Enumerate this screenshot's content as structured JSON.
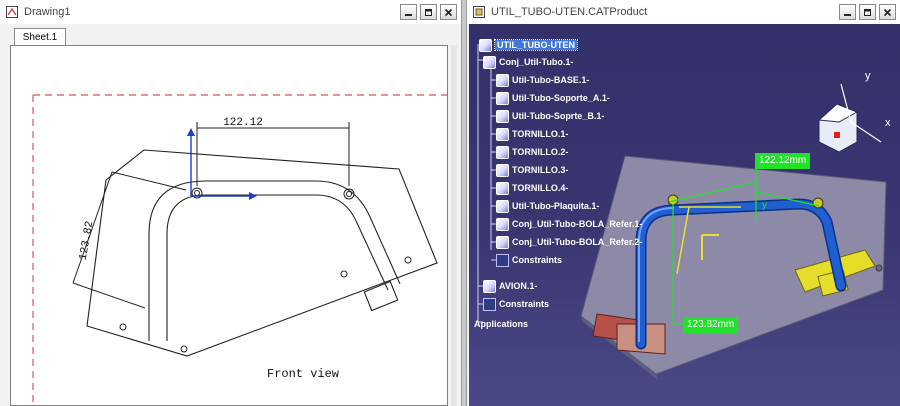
{
  "drawing_window": {
    "title": "Drawing1",
    "tab": "Sheet.1",
    "dim_horizontal": "122.12",
    "dim_vertical": "123.82",
    "view_label": "Front view"
  },
  "product_window": {
    "title": "UTIL_TUBO-UTEN.CATProduct",
    "tree": [
      {
        "label": "UTIL_TUBO-UTEN",
        "icon": "product-icon",
        "selected": true
      },
      {
        "label": "Conj_Util-Tubo.1-",
        "icon": "product-icon"
      },
      {
        "label": "Util-Tubo-BASE.1-",
        "icon": "part-icon"
      },
      {
        "label": "Util-Tubo-Soporte_A.1-",
        "icon": "part-icon"
      },
      {
        "label": "Util-Tubo-Soprte_B.1-",
        "icon": "part-icon"
      },
      {
        "label": "TORNILLO.1-",
        "icon": "part-icon"
      },
      {
        "label": "TORNILLO.2-",
        "icon": "part-icon"
      },
      {
        "label": "TORNILLO.3-",
        "icon": "part-icon"
      },
      {
        "label": "TORNILLO.4-",
        "icon": "part-icon"
      },
      {
        "label": "Util-Tubo-Plaquita.1-",
        "icon": "part-icon"
      },
      {
        "label": "Conj_Util-Tubo-BOLA_Refer.1-",
        "icon": "product-icon"
      },
      {
        "label": "Conj_Util-Tubo-BOLA_Refer.2-",
        "icon": "product-icon"
      },
      {
        "label": "Constraints",
        "icon": "constraints-icon"
      },
      {
        "label": "AVION.1-",
        "icon": "product-icon"
      },
      {
        "label": "Constraints",
        "icon": "constraints-icon"
      },
      {
        "label": "Applications",
        "icon": "applications-icon"
      }
    ],
    "measure_horizontal": "122.12mm",
    "measure_vertical": "123.82mm",
    "compass_y": "y",
    "compass_x": "x",
    "axis_y": "y"
  },
  "colors": {
    "background_3d": "#37336e",
    "measure_label": "#22e12a",
    "tube": "#1f5fd0",
    "tree_selection": "#3f78d8"
  }
}
